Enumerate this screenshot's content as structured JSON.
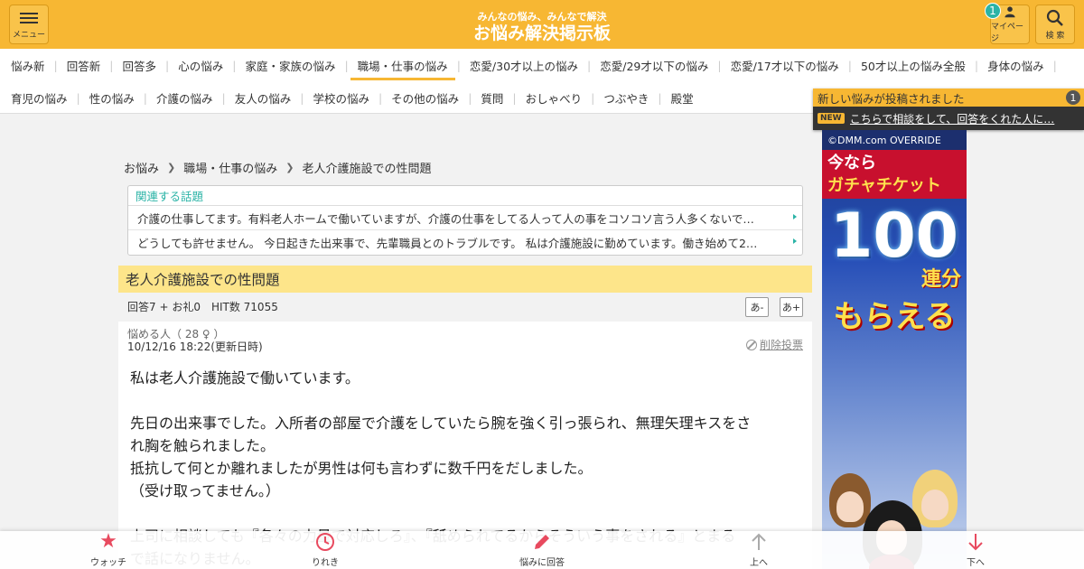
{
  "header": {
    "menu_label": "メニュー",
    "site_sub": "みんなの悩み、みんなで解決",
    "site_title": "お悩み解決掲示板",
    "mypage_label": "マイページ",
    "mypage_badge": "1",
    "search_label": "検 索",
    "accent_color": "#f7b733"
  },
  "catnav": {
    "row1": [
      "悩み新",
      "回答新",
      "回答多",
      "心の悩み",
      "家庭・家族の悩み",
      "職場・仕事の悩み",
      "恋愛/30才以上の悩み",
      "恋愛/29才以下の悩み",
      "恋愛/17才以下の悩み",
      "50才以上の悩み全般",
      "身体の悩み"
    ],
    "row2": [
      "育児の悩み",
      "性の悩み",
      "介護の悩み",
      "友人の悩み",
      "学校の悩み",
      "その他の悩み",
      "質問",
      "おしゃべり",
      "つぶやき",
      "殿堂"
    ],
    "active": "職場・仕事の悩み"
  },
  "notification": {
    "title": "新しい悩みが投稿されました",
    "count": "1",
    "new_tag": "NEW",
    "text": "こちらで相談をして、回答をくれた人に…"
  },
  "ad": {
    "copyright": "©DMM.com OVERRIDE",
    "line1": "今なら",
    "line2": "ガチャチケット",
    "big_number": "100",
    "ren": "連分",
    "moraeru": "もらえる"
  },
  "breadcrumb": [
    "お悩み",
    "職場・仕事の悩み",
    "老人介護施設での性問題"
  ],
  "related": {
    "heading": "関連する話題",
    "items": [
      "介護の仕事してます。有料老人ホームで働いていますが、介護の仕事をしてる人って人の事をコソコソ言う人多くないで…",
      "どうしても許せません。 今日起きた出来事で、先輩職員とのトラブルです。 私は介護施設に勤めています。働き始めて2…"
    ]
  },
  "thread": {
    "title": "老人介護施設での性問題",
    "stats": "回答7 + お礼0　HIT数 71055",
    "font_smaller": "あ-",
    "font_larger": "あ+"
  },
  "post": {
    "author": "悩める人（ 28 ♀ ）",
    "date": "10/12/16 18:22(更新日時)",
    "delete_vote": "削除投票",
    "body": [
      "私は老人介護施設で働いています。",
      "",
      "先日の出来事でした。入所者の部屋で介護をしていたら腕を強く引っ張られ、無理矢理キスをさ",
      "れ胸を触られました。",
      "抵抗して何とか離れましたが男性は何も言わずに数千円をだしました。",
      "（受け取ってません。）",
      "",
      "上司に相談しても『各々の力量で対応しろ』、『舐められてるからそういう事をされる』とまる",
      "で話になりません。"
    ]
  },
  "bottombar": {
    "watch": "ウォッチ",
    "history": "りれき",
    "reply": "悩みに回答",
    "up": "上へ",
    "down": "下へ"
  }
}
